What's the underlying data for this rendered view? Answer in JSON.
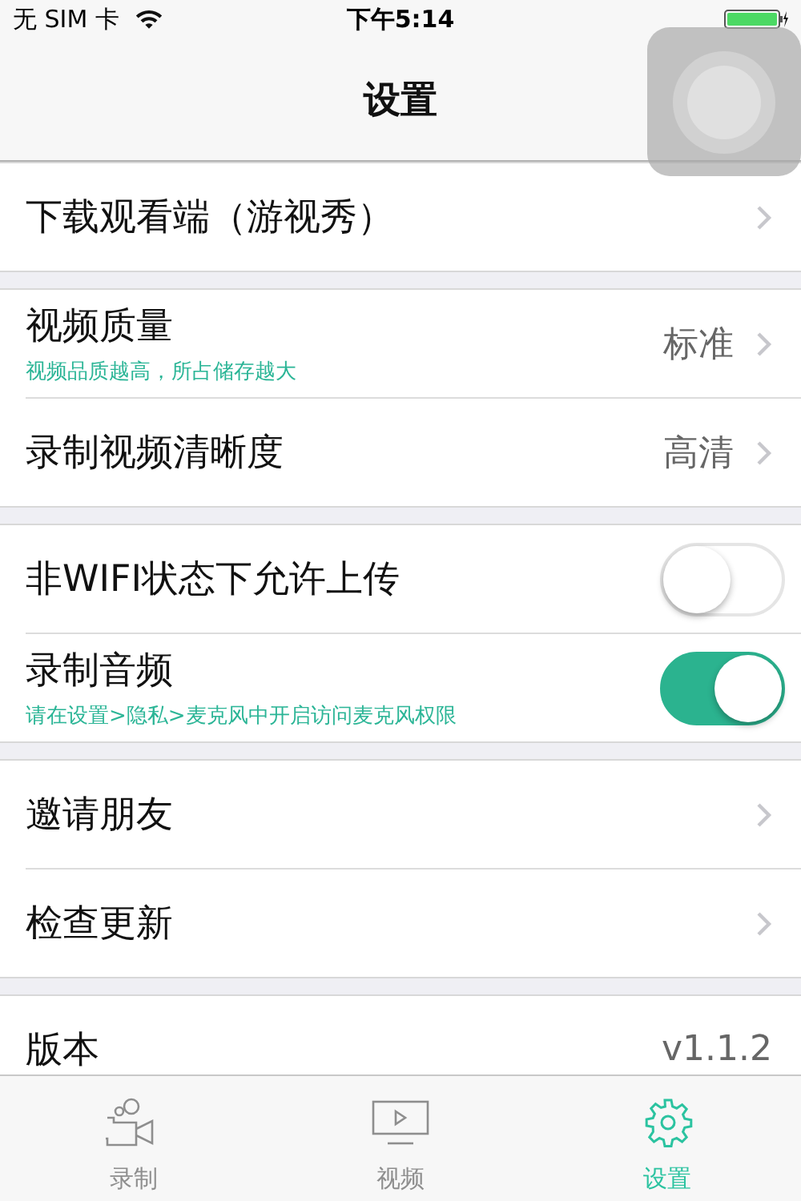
{
  "status_bar": {
    "carrier": "无 SIM 卡",
    "time": "下午5:14"
  },
  "nav": {
    "title": "设置"
  },
  "groups": [
    {
      "rows": [
        {
          "kind": "link",
          "title": "下载观看端（游视秀）"
        }
      ]
    },
    {
      "rows": [
        {
          "kind": "link",
          "title": "视频质量",
          "subtitle": "视频品质越高，所占储存越大",
          "value": "标准"
        },
        {
          "kind": "link",
          "title": "录制视频清晰度",
          "value": "高清"
        }
      ]
    },
    {
      "rows": [
        {
          "kind": "toggle",
          "title": "非WIFI状态下允许上传",
          "on": false
        },
        {
          "kind": "toggle",
          "title": "录制音频",
          "subtitle": "请在设置>隐私>麦克风中开启访问麦克风权限",
          "on": true
        }
      ]
    },
    {
      "rows": [
        {
          "kind": "link",
          "title": "邀请朋友"
        },
        {
          "kind": "link",
          "title": "检查更新"
        }
      ]
    },
    {
      "rows": [
        {
          "kind": "info",
          "title": "版本",
          "value": "v1.1.2"
        }
      ]
    }
  ],
  "tabs": [
    {
      "kind": "record",
      "label": "录制",
      "selected": false
    },
    {
      "kind": "video",
      "label": "视频",
      "selected": false
    },
    {
      "kind": "settings",
      "label": "设置",
      "selected": true
    }
  ]
}
